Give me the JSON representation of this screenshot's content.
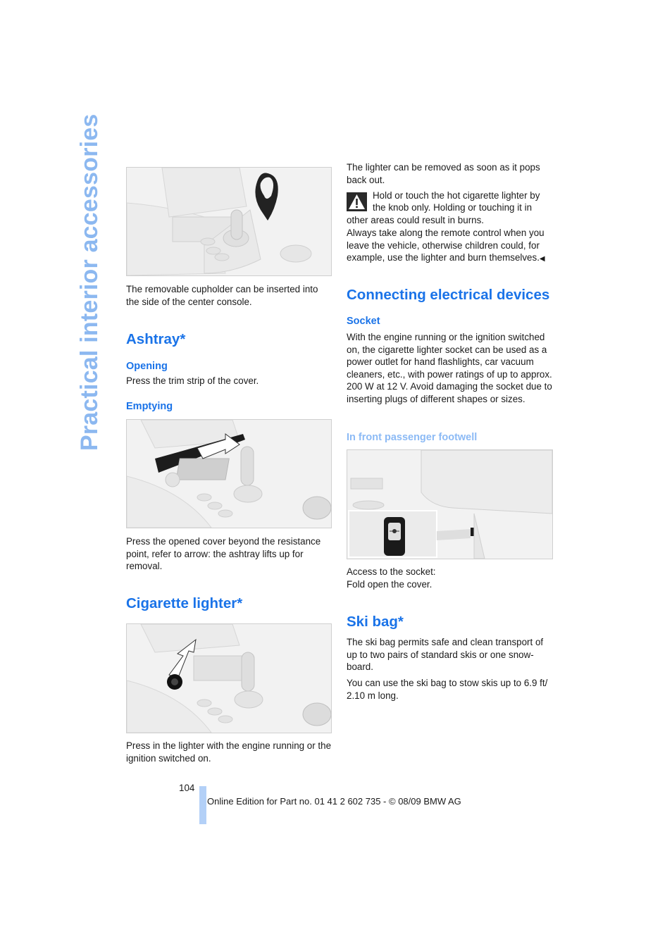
{
  "side_title": "Practical interior accessories",
  "left_column": {
    "cupholder_caption": "The removable cupholder can be inserted into the side of the center console.",
    "ashtray": {
      "heading": "Ashtray*",
      "opening_heading": "Opening",
      "opening_text": "Press the trim strip of the cover.",
      "emptying_heading": "Emptying",
      "emptying_text": "Press the opened cover beyond the resistance point, refer to arrow: the ashtray lifts up for removal."
    },
    "cigarette_lighter": {
      "heading": "Cigarette lighter*",
      "text": "Press in the lighter with the engine running or the ignition switched on."
    }
  },
  "right_column": {
    "lighter_removed_text": "The lighter can be removed as soon as it pops back out.",
    "warning": {
      "icon": "warning-triangle-icon",
      "text_line1": "Hold or touch the hot cigarette lighter by",
      "text_line2": "the knob only. Holding or touching it in",
      "text_rest": "other areas could result in burns.",
      "text2": "Always take along the remote control when you leave the vehicle, otherwise children could, for example, use the lighter and burn themselves.",
      "end_mark": "◀"
    },
    "connecting": {
      "heading": "Connecting electrical devices",
      "socket_heading": "Socket",
      "socket_text": "With the engine running or the ignition switched on, the cigarette lighter socket can be used as a power outlet for hand flashlights, car vacuum cleaners, etc., with power ratings of up to approx. 200 W at 12 V. Avoid damaging the socket due to inserting plugs of different shapes or sizes.",
      "footwell_heading": "In front passenger footwell",
      "access_text_line1": "Access to the socket:",
      "access_text_line2": "Fold open the cover."
    },
    "ski_bag": {
      "heading": "Ski bag*",
      "text1": "The ski bag permits safe and clean transport of up to two pairs of standard skis or one snow-board.",
      "text2": "You can use the ski bag to stow skis up to 6.9 ft/ 2.10 m long."
    }
  },
  "footer": {
    "page_number": "104",
    "edition_text": "Online Edition for Part no. 01 41 2 602 735 - © 08/09 BMW AG"
  },
  "colors": {
    "heading_blue": "#1a73e8",
    "light_blue": "#8cbaf5",
    "footer_bar": "#b3d0f7"
  }
}
